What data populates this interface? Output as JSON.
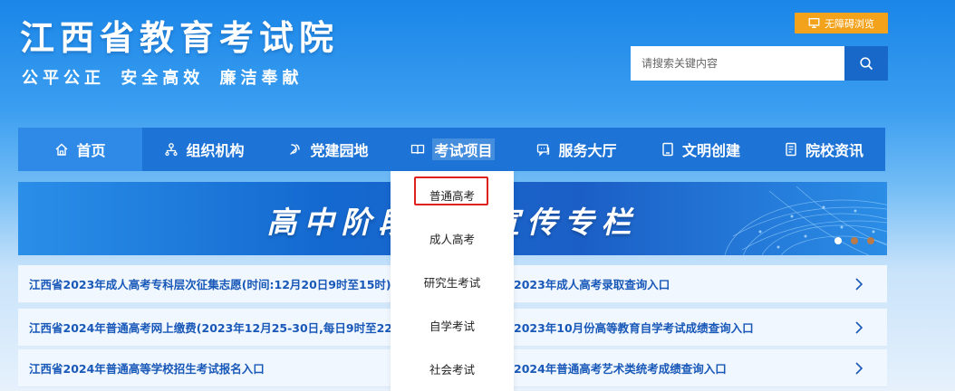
{
  "header": {
    "title": "江西省教育考试院",
    "slogan": "公平公正 安全高效 廉洁奉献",
    "accessibility_label": "无障碍浏览"
  },
  "search": {
    "placeholder": "请搜索关键内容",
    "value": ""
  },
  "nav": {
    "items": [
      {
        "label": "首页",
        "icon": "home-icon"
      },
      {
        "label": "组织机构",
        "icon": "org-chart-icon"
      },
      {
        "label": "党建园地",
        "icon": "party-icon"
      },
      {
        "label": "考试项目",
        "icon": "book-icon"
      },
      {
        "label": "服务大厅",
        "icon": "chat-icon"
      },
      {
        "label": "文明创建",
        "icon": "tablet-icon"
      },
      {
        "label": "院校资讯",
        "icon": "document-icon"
      }
    ]
  },
  "banner": {
    "text_left": "高中阶段学",
    "text_right": "生宣传专栏"
  },
  "dropdown": {
    "items": [
      "普通高考",
      "成人高考",
      "研究生考试",
      "自学考试",
      "社会考试"
    ]
  },
  "news_left": [
    "江西省2023年成人高考专科层次征集志愿(时间:12月20日9时至15时)",
    "江西省2024年普通高考网上缴费(2023年12月25-30日,每日9时至22时",
    "江西省2024年普通高等学校招生考试报名入口"
  ],
  "news_right": [
    "2023年成人高考录取查询入口",
    "2023年10月份高等教育自学考试成绩查询入口",
    "2024年普通高考艺术类统考成绩查询入口"
  ],
  "colors": {
    "nav_bg": "#1d74d6",
    "accent_orange": "#f3a21b",
    "highlight_red": "#e0201a",
    "link_blue": "#1858b8"
  }
}
